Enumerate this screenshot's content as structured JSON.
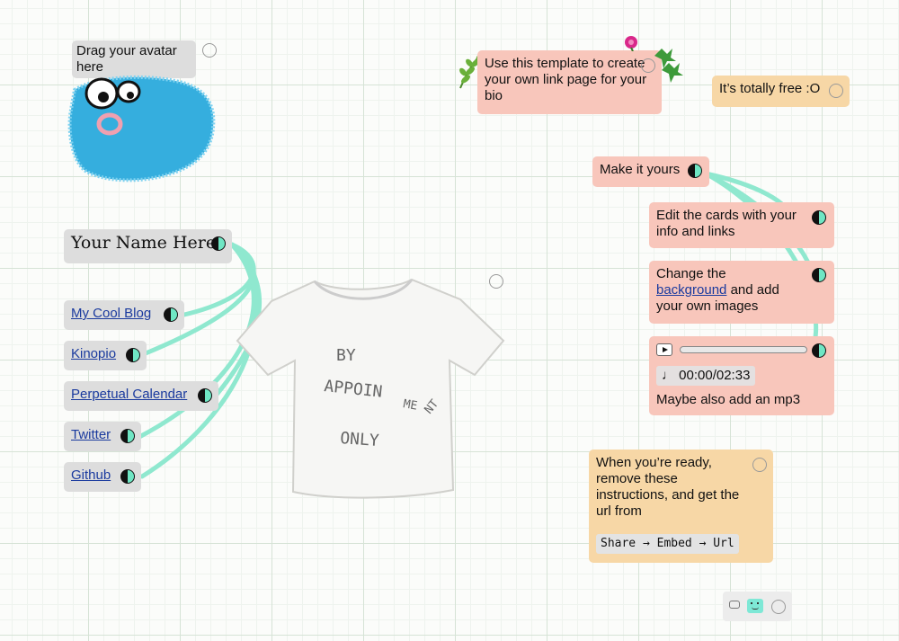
{
  "avatar_card": {
    "label": "Drag your avatar here"
  },
  "intro_card": {
    "text": "Use this template to create your own link page for your bio"
  },
  "free_card": {
    "text": "It’s totally free :O"
  },
  "make_card": {
    "text": "Make it yours"
  },
  "edit_card": {
    "text": "Edit the cards with your info and links"
  },
  "background_card": {
    "before": "Change the",
    "link": "background",
    "after": "and add your own images"
  },
  "audio_card": {
    "time": "00:00/02:33",
    "caption": "Maybe also add an mp3"
  },
  "ready_card": {
    "text": "When you’re ready, remove these instructions, and get the url from",
    "code": "Share → Embed → Url"
  },
  "name_card": {
    "text": "Your Name Here"
  },
  "tshirt": {
    "lines": [
      "BY",
      "APPOIN",
      "ME",
      "NT",
      "ONLY"
    ]
  },
  "links": [
    {
      "label": "My Cool Blog"
    },
    {
      "label": "Kinopio"
    },
    {
      "label": "Perpetual Calendar"
    },
    {
      "label": "Twitter"
    },
    {
      "label": "Github"
    }
  ],
  "colors": {
    "connection": "#8fe8cf",
    "pink": "#f8c6bb",
    "orange": "#f7d7a6",
    "gray": "#dddddd"
  }
}
